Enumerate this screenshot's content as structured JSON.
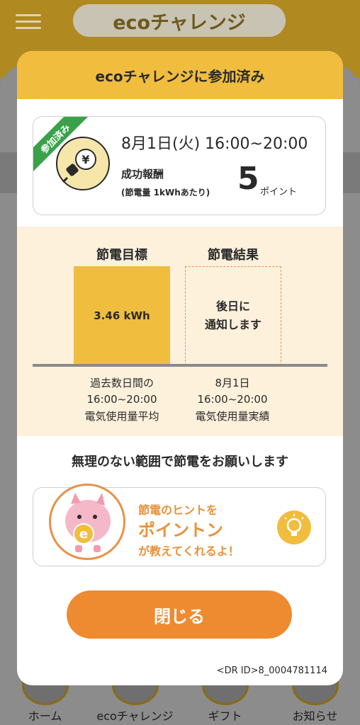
{
  "background": {
    "title": "ecoチャレンジ",
    "nav": [
      {
        "label": "ホーム"
      },
      {
        "label": "ecoチャレンジ"
      },
      {
        "label": "ギフト"
      },
      {
        "label": "お知らせ"
      }
    ]
  },
  "modal": {
    "header": "ecoチャレンジに参加済み",
    "event": {
      "badge": "参加済み",
      "date": "8月1日(火) 16:00~20:00",
      "reward_label": "成功報酬",
      "reward_note": "(節電量 1kWhあたり)",
      "points": "5",
      "points_unit": "ポイント"
    },
    "chart": {
      "target_title": "節電目標",
      "result_title": "節電結果",
      "target_value": "3.46 kWh",
      "result_line1": "後日に",
      "result_line2": "通知します",
      "target_caption": [
        "過去数日間の",
        "16:00~20:00",
        "電気使用量平均"
      ],
      "result_caption": [
        "8月1日",
        "16:00~20:00",
        "電気使用量実績"
      ]
    },
    "request": "無理のない範囲で節電をお願いします",
    "hint": {
      "line1": "節電のヒントを",
      "line2": "ポイントン",
      "line3": "が教えてくれるよ！"
    },
    "close_label": "閉じる",
    "dr_id": "<DR ID>8_0004781114"
  },
  "colors": {
    "accent_yellow": "#f0bd3f",
    "accent_orange": "#ee8b31",
    "badge_green": "#3aa14a",
    "chart_bg": "#fdf1dc"
  }
}
